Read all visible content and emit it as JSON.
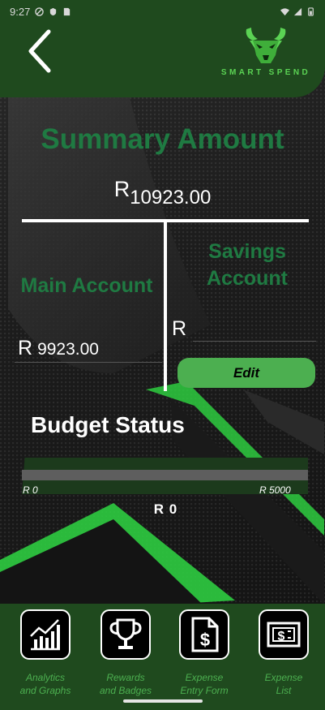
{
  "status_bar": {
    "time": "9:27"
  },
  "header": {
    "logo_text": "SMART SPEND"
  },
  "summary": {
    "title": "Summary Amount",
    "currency": "R",
    "total": "10923.00"
  },
  "main_account": {
    "title": "Main Account",
    "currency": "R",
    "amount": "9923.00"
  },
  "savings_account": {
    "title_line1": "Savings",
    "title_line2": "Account",
    "currency": "R",
    "edit_label": "Edit"
  },
  "budget": {
    "title": "Budget Status",
    "min_label": "R 0",
    "max_label": "R 5000",
    "current_label": "R 0",
    "current_fraction": 0
  },
  "bottom_nav": {
    "items": [
      {
        "line1": "Analytics",
        "line2": "and Graphs",
        "icon": "analytics-chart-icon"
      },
      {
        "line1": "Rewards",
        "line2": "and Badges",
        "icon": "trophy-icon"
      },
      {
        "line1": "Expense",
        "line2": "Entry Form",
        "icon": "document-dollar-icon"
      },
      {
        "line1": "Expense",
        "line2": "List",
        "icon": "money-bill-icon"
      }
    ]
  },
  "colors": {
    "header_green": "#1f4a1e",
    "title_green": "#1f7a42",
    "button_green": "#4caf50",
    "logo_green": "#5bd354"
  }
}
